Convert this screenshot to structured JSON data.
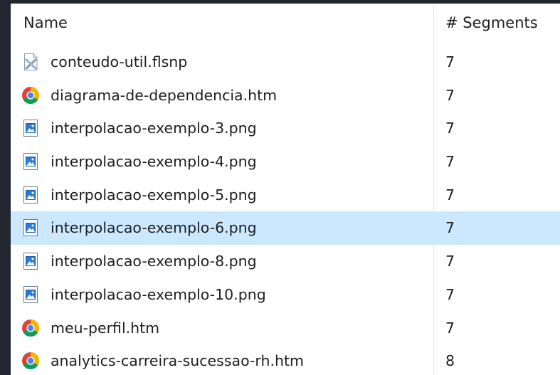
{
  "columns": {
    "name": "Name",
    "segments": "# Segments"
  },
  "files": [
    {
      "name": "conteudo-util.flsnp",
      "segments": "7",
      "icon": "unknown-file-icon",
      "selected": false
    },
    {
      "name": "diagrama-de-dependencia.htm",
      "segments": "7",
      "icon": "chrome-icon",
      "selected": false
    },
    {
      "name": "interpolacao-exemplo-3.png",
      "segments": "7",
      "icon": "image-file-icon",
      "selected": false
    },
    {
      "name": "interpolacao-exemplo-4.png",
      "segments": "7",
      "icon": "image-file-icon",
      "selected": false
    },
    {
      "name": "interpolacao-exemplo-5.png",
      "segments": "7",
      "icon": "image-file-icon",
      "selected": false
    },
    {
      "name": "interpolacao-exemplo-6.png",
      "segments": "7",
      "icon": "image-file-icon",
      "selected": true
    },
    {
      "name": "interpolacao-exemplo-8.png",
      "segments": "7",
      "icon": "image-file-icon",
      "selected": false
    },
    {
      "name": "interpolacao-exemplo-10.png",
      "segments": "7",
      "icon": "image-file-icon",
      "selected": false
    },
    {
      "name": "meu-perfil.htm",
      "segments": "7",
      "icon": "chrome-icon",
      "selected": false
    },
    {
      "name": "analytics-carreira-sucessao-rh.htm",
      "segments": "8",
      "icon": "chrome-icon",
      "selected": false
    }
  ],
  "colors": {
    "background": "#21262f",
    "selected_row": "#cce8ff",
    "text": "#1e1e1e"
  }
}
